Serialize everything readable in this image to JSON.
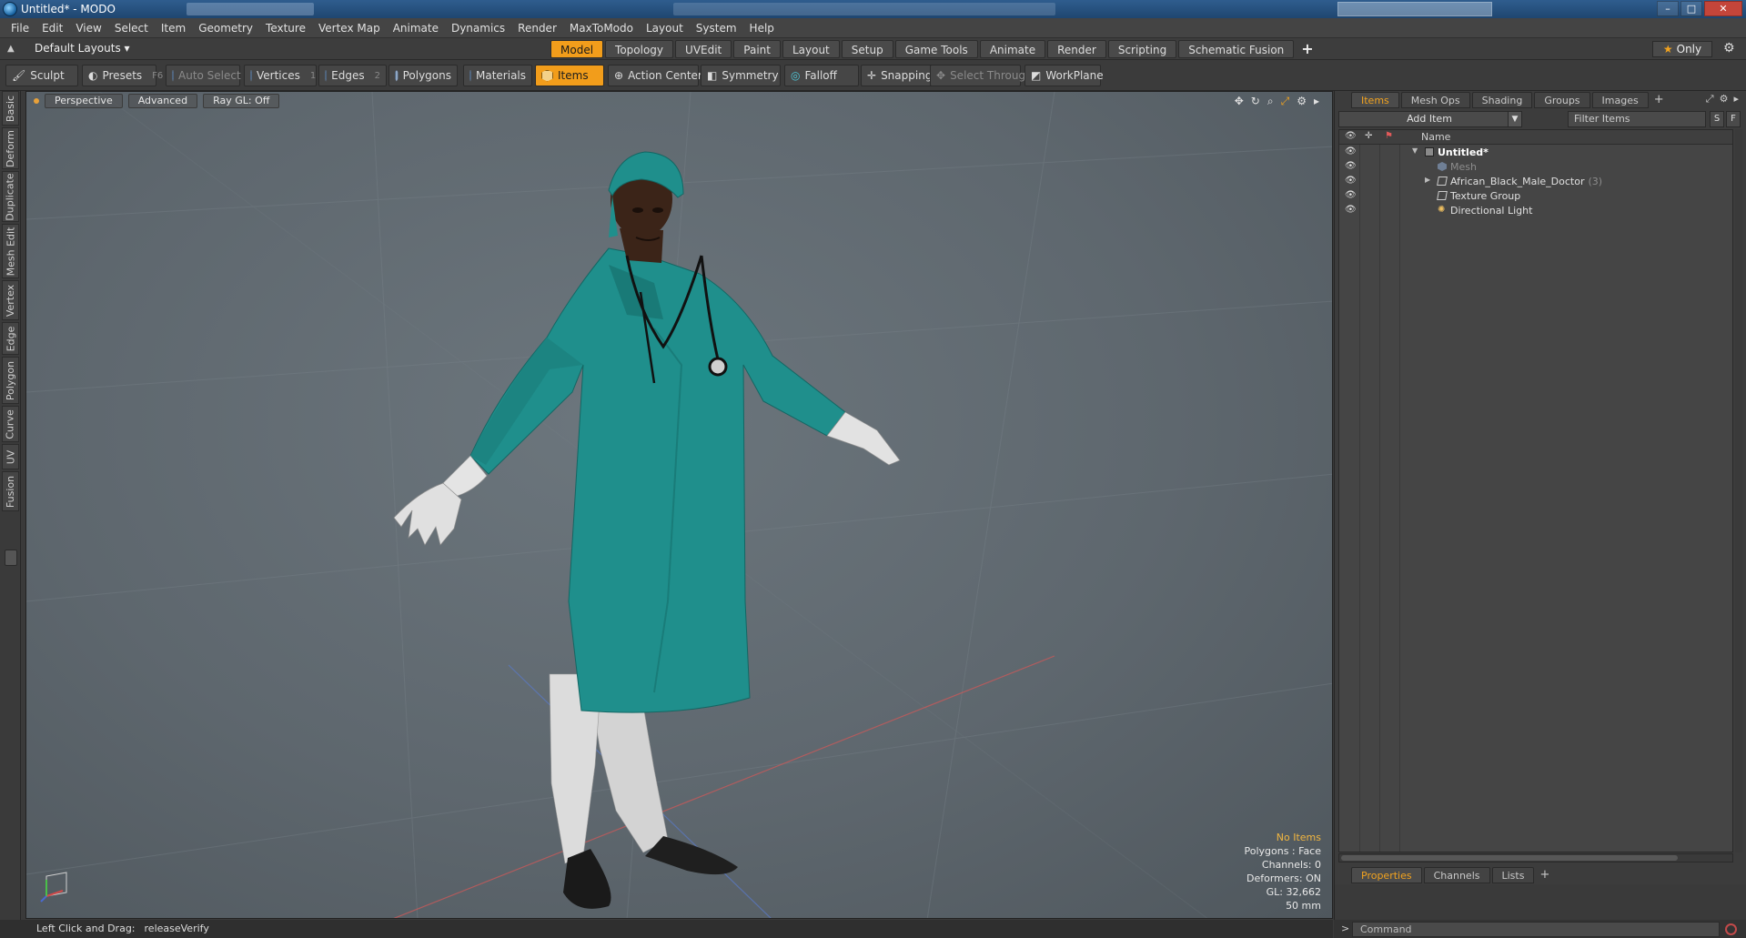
{
  "window": {
    "title": "Untitled* - MODO"
  },
  "window_controls": {
    "minimize": "–",
    "maximize": "□",
    "close": "✕"
  },
  "menu": [
    "File",
    "Edit",
    "View",
    "Select",
    "Item",
    "Geometry",
    "Texture",
    "Vertex Map",
    "Animate",
    "Dynamics",
    "Render",
    "MaxToModo",
    "Layout",
    "System",
    "Help"
  ],
  "layout_bar": {
    "layouts_label": "Default Layouts ▾",
    "tabs": [
      "Model",
      "Topology",
      "UVEdit",
      "Paint",
      "Layout",
      "Setup",
      "Game Tools",
      "Animate",
      "Render",
      "Scripting",
      "Schematic Fusion"
    ],
    "active_tab": "Model",
    "add_tab": "+",
    "only_label": "Only"
  },
  "toolbar": {
    "sculpt": "Sculpt",
    "presets": "Presets",
    "presets_hotkey": "F6",
    "auto_select": "Auto Select",
    "vertices": "Vertices",
    "vertices_hotkey": "1",
    "edges": "Edges",
    "edges_hotkey": "2",
    "polygons": "Polygons",
    "materials": "Materials",
    "items": "Items",
    "action_center": "Action Center",
    "symmetry": "Symmetry",
    "falloff": "Falloff",
    "snapping": "Snapping",
    "select_through": "Select Through",
    "workplane": "WorkPlane"
  },
  "side_tabs": [
    "Basic",
    "Deform",
    "Duplicate",
    "Mesh Edit",
    "Vertex",
    "Edge",
    "Polygon",
    "Curve",
    "UV",
    "Fusion"
  ],
  "viewport": {
    "view_mode": "Perspective",
    "shading": "Advanced",
    "raygl": "Ray GL: Off",
    "info": {
      "no_items": "No Items",
      "polygons": "Polygons : Face",
      "channels": "Channels: 0",
      "deformers": "Deformers: ON",
      "gl": "GL: 32,662",
      "focal": "50 mm"
    },
    "colors": {
      "scrubs": "#1e8f8c",
      "gloves": "#e2e2e2",
      "skin": "#3b2418",
      "pants": "#d8d8d8",
      "shoes": "#1c1c1c"
    }
  },
  "items_panel": {
    "tabs": [
      "Items",
      "Mesh Ops",
      "Shading",
      "Groups",
      "Images"
    ],
    "active_tab": "Items",
    "add_tab": "+",
    "add_item": "Add Item",
    "filter_placeholder": "Filter Items",
    "s_button": "S",
    "f_button": "F",
    "name_header": "Name",
    "tree": [
      {
        "label": "Untitled*",
        "icon": "scene-icon"
      },
      {
        "label": "Mesh",
        "icon": "mesh-icon"
      },
      {
        "label": "African_Black_Male_Doctor",
        "count": "(3)",
        "icon": "locator-icon"
      },
      {
        "label": "Texture Group",
        "icon": "group-icon"
      },
      {
        "label": "Directional Light",
        "icon": "light-icon"
      }
    ]
  },
  "properties_panel": {
    "tabs": [
      "Properties",
      "Channels",
      "Lists"
    ],
    "active_tab": "Properties",
    "add_tab": "+"
  },
  "status": {
    "hint_label": "Left Click and Drag:",
    "hint_value": "releaseVerify"
  },
  "command": {
    "prompt": ">",
    "placeholder": "Command"
  }
}
